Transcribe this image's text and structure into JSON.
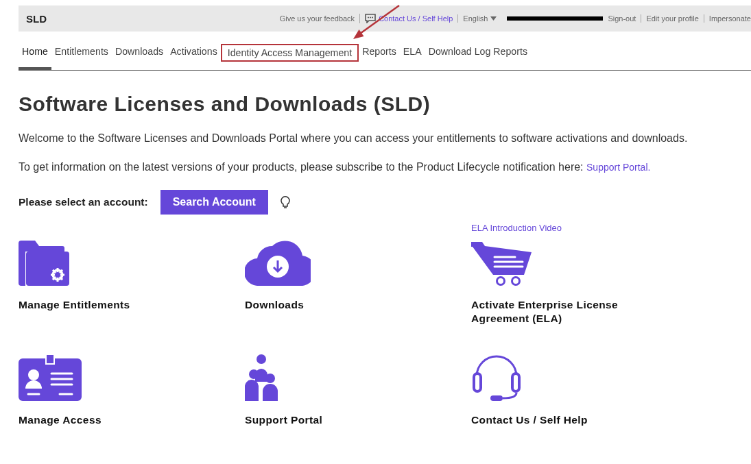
{
  "header": {
    "brand": "SLD",
    "links": [
      {
        "kind": "text",
        "label": "Give us your feedback"
      },
      {
        "kind": "contact",
        "label": "Contact Us / Self Help"
      },
      {
        "kind": "language",
        "label": "English"
      },
      {
        "kind": "redacted"
      },
      {
        "kind": "text",
        "label": "Sign-out"
      },
      {
        "kind": "text",
        "label": "Edit your profile"
      },
      {
        "kind": "text",
        "label": "Impersonate"
      }
    ]
  },
  "tabs": [
    {
      "label": "Home",
      "selected": true,
      "callout": false
    },
    {
      "label": "Entitlements",
      "selected": false,
      "callout": false
    },
    {
      "label": "Downloads",
      "selected": false,
      "callout": false
    },
    {
      "label": "Activations",
      "selected": false,
      "callout": false
    },
    {
      "label": "Identity Access Management",
      "selected": false,
      "callout": true
    },
    {
      "label": "Reports",
      "selected": false,
      "callout": false
    },
    {
      "label": "ELA",
      "selected": false,
      "callout": false
    },
    {
      "label": "Download Log Reports",
      "selected": false,
      "callout": false
    }
  ],
  "title": "Software Licenses and Downloads (SLD)",
  "intro": "Welcome to the Software Licenses and Downloads Portal where you can access your entitlements to software activations and downloads.",
  "lifecycle": {
    "text": "To get information on the latest versions of your products, please subscribe to the Product Lifecycle notification here:",
    "link": "Support Portal."
  },
  "account": {
    "label": "Please select an account:",
    "button": "Search Account"
  },
  "tiles": [
    {
      "kind": "entitlements",
      "label": "Manage Entitlements"
    },
    {
      "kind": "downloads",
      "label": "Downloads"
    },
    {
      "kind": "ela",
      "label": "Activate Enterprise License Agreement (ELA)",
      "link": "ELA Introduction Video"
    },
    {
      "kind": "access",
      "label": "Manage Access"
    },
    {
      "kind": "support",
      "label": "Support Portal"
    },
    {
      "kind": "contact",
      "label": "Contact Us / Self Help"
    }
  ]
}
